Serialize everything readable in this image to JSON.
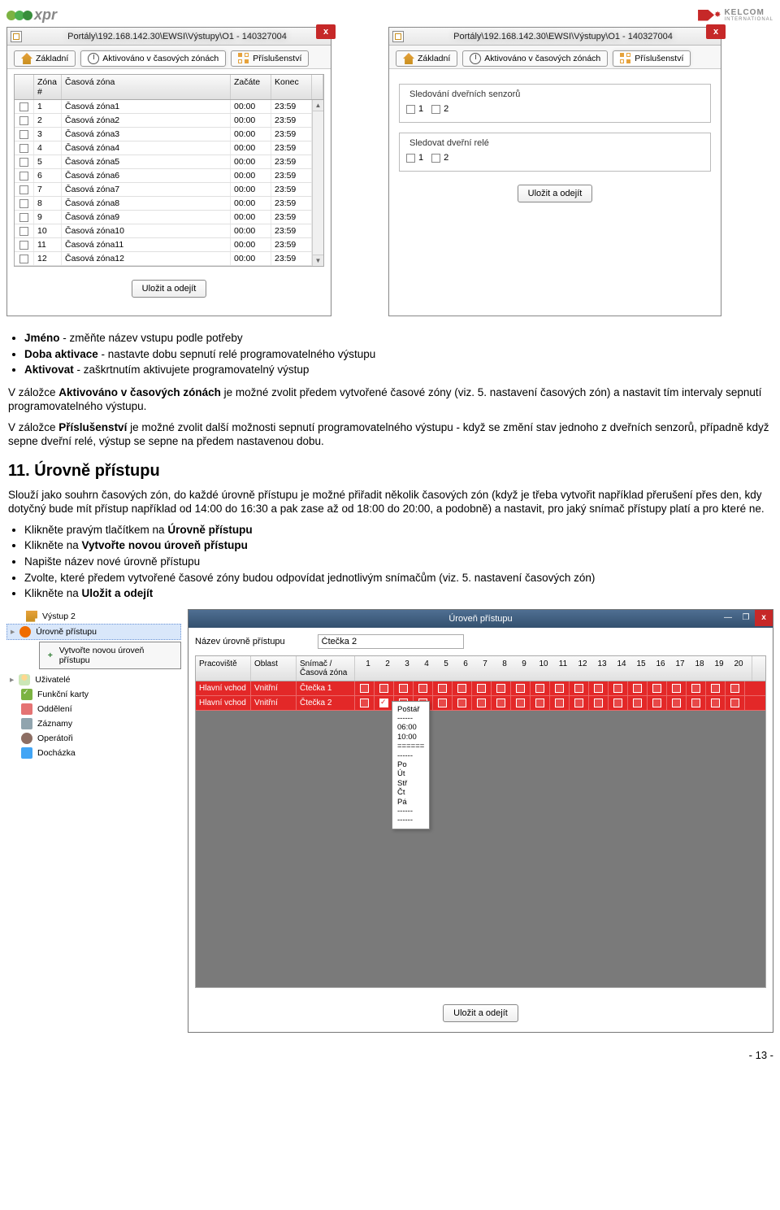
{
  "header": {
    "left_logo": "xpr",
    "right_logo_brand": "KELCOM",
    "right_logo_suffix": "INTERNATIONAL"
  },
  "windows": {
    "title_both": "Portály\\192.168.142.30\\EWSI\\Výstupy\\O1 - 140327004",
    "close_label": "x",
    "tabs": {
      "basic": "Základní",
      "timezone": "Aktivováno v časových zónách",
      "accessories": "Příslušenství"
    },
    "left": {
      "columns": {
        "zone_num": "Zóna #",
        "zone": "Časová zóna",
        "start": "Začáte",
        "end": "Konec"
      },
      "rows": [
        {
          "n": "1",
          "name": "Časová zóna1",
          "s": "00:00",
          "e": "23:59"
        },
        {
          "n": "2",
          "name": "Časová zóna2",
          "s": "00:00",
          "e": "23:59"
        },
        {
          "n": "3",
          "name": "Časová zóna3",
          "s": "00:00",
          "e": "23:59"
        },
        {
          "n": "4",
          "name": "Časová zóna4",
          "s": "00:00",
          "e": "23:59"
        },
        {
          "n": "5",
          "name": "Časová zóna5",
          "s": "00:00",
          "e": "23:59"
        },
        {
          "n": "6",
          "name": "Časová zóna6",
          "s": "00:00",
          "e": "23:59"
        },
        {
          "n": "7",
          "name": "Časová zóna7",
          "s": "00:00",
          "e": "23:59"
        },
        {
          "n": "8",
          "name": "Časová zóna8",
          "s": "00:00",
          "e": "23:59"
        },
        {
          "n": "9",
          "name": "Časová zóna9",
          "s": "00:00",
          "e": "23:59"
        },
        {
          "n": "10",
          "name": "Časová zóna10",
          "s": "00:00",
          "e": "23:59"
        },
        {
          "n": "11",
          "name": "Časová zóna11",
          "s": "00:00",
          "e": "23:59"
        },
        {
          "n": "12",
          "name": "Časová zóna12",
          "s": "00:00",
          "e": "23:59"
        }
      ]
    },
    "right": {
      "fieldset1_legend": "Sledování dveřních senzorů",
      "fieldset2_legend": "Sledovat dveřní relé",
      "option1": "1",
      "option2": "2"
    },
    "save_button": "Uložit a odejít"
  },
  "doc1": {
    "li1_b": "Jméno",
    "li1_rest": " - změňte název vstupu podle potřeby",
    "li2_b": "Doba aktivace",
    "li2_rest": " - nastavte dobu sepnutí relé programovatelného výstupu",
    "li3_b": "Aktivovat",
    "li3_rest": " - zaškrtnutím aktivujete programovatelný výstup",
    "p1_a": "V záložce ",
    "p1_b": "Aktivováno v časových zónách",
    "p1_c": " je možné zvolit předem vytvořené časové zóny (viz. 5. nastavení časových zón) a nastavit tím intervaly sepnutí programovatelného výstupu.",
    "p2_a": "V záložce ",
    "p2_b": "Příslušenství",
    "p2_c": " je možné zvolit další možnosti sepnutí programovatelného výstupu - když se změní stav jednoho z dveřních senzorů, případně když sepne dveřní relé, výstup se sepne na předem nastavenou dobu."
  },
  "doc2": {
    "heading": "11. Úrovně přístupu",
    "para": "Slouží jako souhrn časových zón, do každé úrovně přístupu je možné přiřadit několik časových zón (když je třeba vytvořit například přerušení přes den, kdy dotyčný bude mít přístup například od 14:00 do 16:30 a pak zase až od 18:00 do 20:00, a podobně) a nastavit, pro jaký snímač přístupy platí a pro které ne.",
    "li1a": "Klikněte pravým tlačítkem na ",
    "li1b": "Úrovně přístupu",
    "li2a": "Klikněte na ",
    "li2b": "Vytvořte novou úroveň přístupu",
    "li3": "Napište název nové úrovně přístupu",
    "li4": "Zvolte, které předem vytvořené časové zóny budou odpovídat jednotlivým snímačům (viz. 5. nastavení časových zón)",
    "li5a": "Klikněte na ",
    "li5b": "Uložit a odejít"
  },
  "tree": {
    "output2": "Výstup 2",
    "levels": "Úrovně přístupu",
    "context_create": "Vytvořte novou úroveň přístupu",
    "users": "Uživatelé",
    "fcards": "Funkční karty",
    "depts": "Oddělení",
    "records": "Záznamy",
    "operators": "Operátoři",
    "attendance": "Docházka"
  },
  "level_window": {
    "title": "Úroveň přístupu",
    "min": "—",
    "max": "❐",
    "close": "x",
    "name_label": "Název úrovně přístupu",
    "name_value": "Čtečka 2",
    "cols": {
      "site": "Pracoviště",
      "area": "Oblast",
      "reader": "Snímač /\nČasová zóna",
      "nums": [
        "1",
        "2",
        "3",
        "4",
        "5",
        "6",
        "7",
        "8",
        "9",
        "10",
        "11",
        "12",
        "13",
        "14",
        "15",
        "16",
        "17",
        "18",
        "19",
        "20"
      ]
    },
    "rows": [
      {
        "site": "Hlavní vchod",
        "area": "Vnitřní",
        "reader": "Čtečka 1",
        "checked": []
      },
      {
        "site": "Hlavní vchod",
        "area": "Vnitřní",
        "reader": "Čtečka 2",
        "checked": [
          2
        ]
      }
    ],
    "tooltip": "Poštář\n------\n06:00\n10:00\n======\n------\nPo\nÚt\nStř\nČt\nPá\n------\n------",
    "save": "Uložit a odejít"
  },
  "page_num": "- 13 -"
}
